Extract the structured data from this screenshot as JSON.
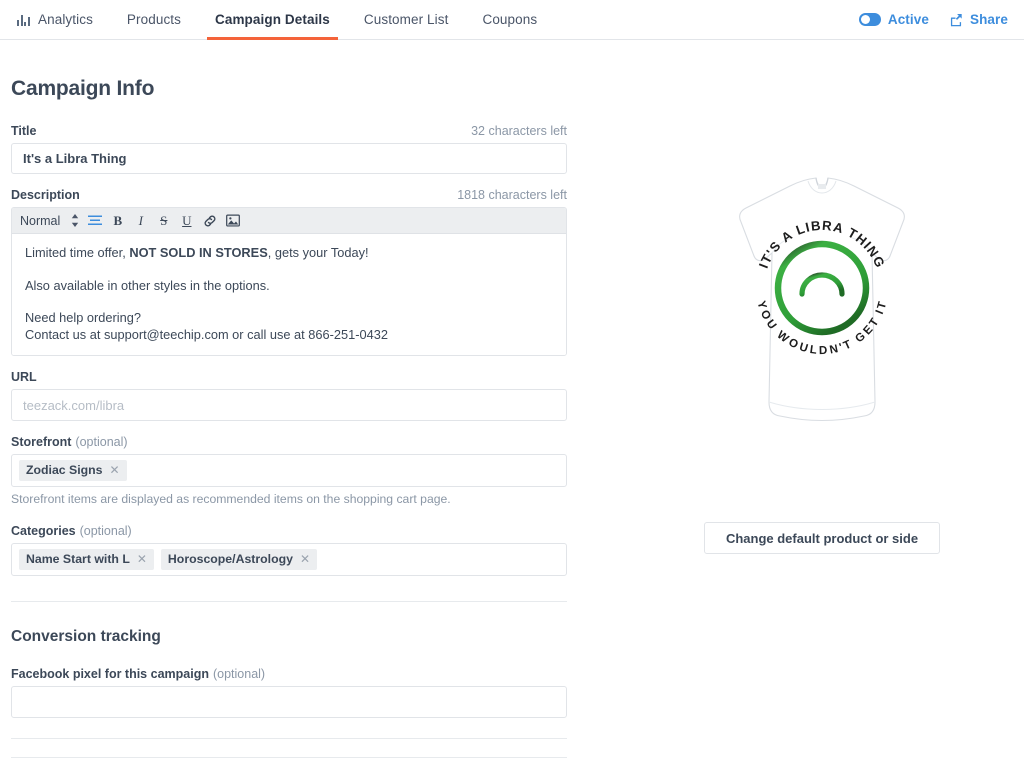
{
  "nav": {
    "tabs": [
      {
        "label": "Analytics",
        "icon": "bar-chart-icon",
        "active": false
      },
      {
        "label": "Products",
        "icon": "",
        "active": false
      },
      {
        "label": "Campaign Details",
        "icon": "",
        "active": true
      },
      {
        "label": "Customer List",
        "icon": "",
        "active": false
      },
      {
        "label": "Coupons",
        "icon": "",
        "active": false
      }
    ],
    "active_toggle_label": "Active",
    "share_label": "Share",
    "accent_color": "#f4633a",
    "link_color": "#3d8ddd"
  },
  "page": {
    "title": "Campaign Info"
  },
  "title_field": {
    "label": "Title",
    "characters_left": "32 characters left",
    "value": "It's a Libra Thing"
  },
  "description_field": {
    "label": "Description",
    "characters_left": "1818 characters left",
    "toolbar": {
      "format_value": "Normal",
      "buttons": [
        {
          "name": "align-icon",
          "glyph": "≡",
          "active": true
        },
        {
          "name": "bold-icon",
          "glyph": "B",
          "active": false
        },
        {
          "name": "italic-icon",
          "glyph": "I",
          "active": false
        },
        {
          "name": "strikethrough-icon",
          "glyph": "S",
          "active": false
        },
        {
          "name": "underline-icon",
          "glyph": "U",
          "active": false
        },
        {
          "name": "link-icon",
          "glyph": "❦",
          "active": false
        },
        {
          "name": "image-icon",
          "glyph": "▣",
          "active": false
        }
      ]
    },
    "paragraph1_pre": "Limited time offer, ",
    "paragraph1_bold": "NOT SOLD IN STORES",
    "paragraph1_post": ", gets your Today!",
    "paragraph2": "Also available in other styles in the options.",
    "paragraph3": "Need help ordering?",
    "paragraph4": "Contact us at support@teechip.com or call use at 866-251-0432"
  },
  "url_field": {
    "label": "URL",
    "value": "",
    "placeholder": "teezack.com/libra"
  },
  "storefront_field": {
    "label": "Storefront",
    "optional": "(optional)",
    "tags": [
      "Zodiac Signs"
    ],
    "hint": "Storefront items are displayed as recommended items on the shopping cart page."
  },
  "categories_field": {
    "label": "Categories",
    "optional": "(optional)",
    "tags": [
      "Name Start with L",
      "Horoscope/Astrology"
    ]
  },
  "conversion_tracking": {
    "title": "Conversion tracking",
    "pixel_label": "Facebook pixel for this campaign",
    "optional": "(optional)",
    "pixel_value": "",
    "pixel_placeholder": ""
  },
  "product_preview": {
    "product_type": "ladies-tshirt",
    "shirt_color": "#ffffff",
    "design_color": "#3cb043",
    "text_top": "IT'S A LIBRA THING",
    "text_bottom": "YOU WOULDN'T GET IT",
    "symbol": "libra-zodiac-symbol",
    "change_button_label": "Change default product or side"
  }
}
